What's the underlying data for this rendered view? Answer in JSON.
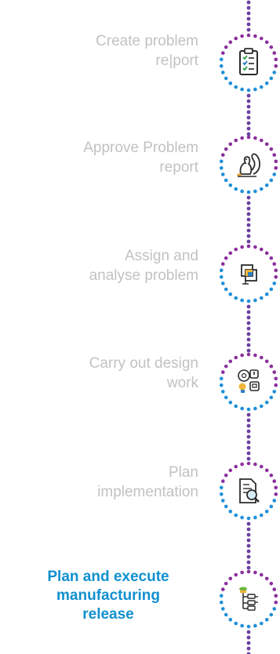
{
  "steps": [
    {
      "label_lines": [
        "Create problem",
        "re|port"
      ],
      "icon": "clipboard-checklist-icon",
      "active": false
    },
    {
      "label_lines": [
        "Approve Problem",
        "report"
      ],
      "icon": "squirrel-icon",
      "active": false
    },
    {
      "label_lines": [
        "Assign and",
        "analyse problem"
      ],
      "icon": "layered-squares-icon",
      "active": false
    },
    {
      "label_lines": [
        "Carry out design",
        "work"
      ],
      "icon": "ideas-bubbles-icon",
      "active": false
    },
    {
      "label_lines": [
        "Plan",
        "implementation"
      ],
      "icon": "document-magnifier-icon",
      "active": false
    },
    {
      "label_lines": [
        "Plan  and execute",
        "manufacturing",
        "release"
      ],
      "icon": "hierarchy-tree-icon",
      "active": true
    }
  ],
  "colors": {
    "connector": "#6a3fa0",
    "ring_purple": "#8a2f9c",
    "ring_blue": "#1f8fd8",
    "active_text": "#1190cf",
    "inactive_text": "#c2c2c2"
  }
}
